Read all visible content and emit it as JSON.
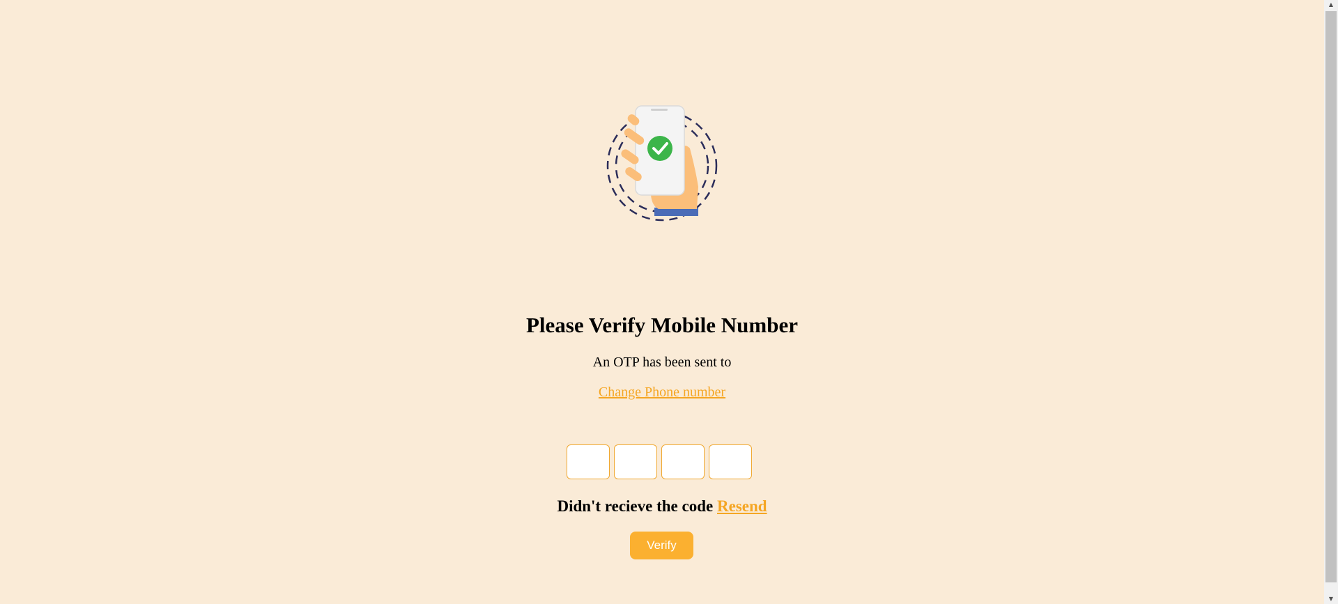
{
  "heading": "Please Verify Mobile Number",
  "subtitle": "An OTP has been sent to",
  "change_phone_link": "Change Phone number",
  "otp": {
    "digits": [
      "",
      "",
      "",
      ""
    ]
  },
  "resend": {
    "prompt": "Didn't recieve the code",
    "link": "Resend"
  },
  "verify_button": "Verify",
  "illustration_icon": "phone-verified-hand-icon",
  "colors": {
    "background": "#FAEBD7",
    "accent": "#F5A623",
    "button": "#FBB030",
    "check": "#3CB54A"
  }
}
